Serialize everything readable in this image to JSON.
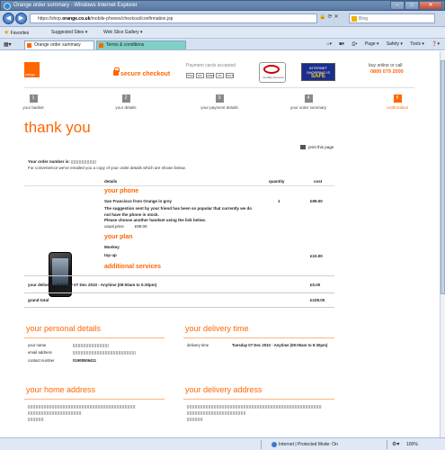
{
  "window": {
    "title": "Orange order summary - Windows Internet Explorer",
    "min": "–",
    "max": "□",
    "close": "✕"
  },
  "address": {
    "url_prefix": "https://shop.",
    "url_domain": "orange.co.uk",
    "url_suffix": "/mobile-phones/checkout/confirmation.jsp",
    "search_placeholder": "Bing"
  },
  "favorites": {
    "label": "Favorites",
    "items": [
      "Suggested Sites ▾",
      "Web Slice Gallery ▾"
    ]
  },
  "tabs": [
    {
      "label": "Orange order summary"
    },
    {
      "label": "Terms & conditions"
    }
  ],
  "commands": [
    "Page ▾",
    "Safety ▾",
    "Tools ▾",
    "❓▾"
  ],
  "header": {
    "logo_text": "orange",
    "secure": "secure checkout",
    "payment_label": "Payment cards accepted",
    "cards": [
      "VISA",
      "MC",
      "AMEX",
      "DC",
      "SOLO"
    ],
    "verisign": "VeriSign Secured",
    "safe_top": "INTERNET SHOPPING IS",
    "safe_word": "SAFE",
    "buy_online": "buy online or call",
    "phone": "0800 079 2000"
  },
  "steps": [
    {
      "num": "1",
      "label": "your basket"
    },
    {
      "num": "2",
      "label": "your details"
    },
    {
      "num": "3",
      "label": "your payment details"
    },
    {
      "num": "4",
      "label": "your order summary"
    },
    {
      "num": "5",
      "label": "confirmation"
    }
  ],
  "page": {
    "thank_you": "thank you",
    "print": "print this page",
    "order_number_label": "Your order number is:",
    "emailed": "For convenience we've emailed you a copy of your order details which are shown below."
  },
  "table": {
    "col_details": "details",
    "col_quantity": "quantity",
    "col_cost": "cost",
    "your_phone": "your phone",
    "phone_name": "San Francisco from Orange in grey",
    "phone_note": "The suggestion sent by your friend has been so popular that currently we do not have the phone in stock.",
    "phone_note2": "Please choose another handset using the link below.",
    "usual_price_label": "usual price",
    "usual_price": "£99.00",
    "phone_qty": "1",
    "phone_cost": "£99.00",
    "your_plan": "your plan",
    "plan_name": "Monkey",
    "top_up": "top up",
    "top_up_cost": "£10.00",
    "additional": "additional services",
    "delivery_row": "your delivery - Tuesday 07 Dec 2010 - Anytime (09:00am to 5:30pm)",
    "delivery_cost": "£0.00",
    "grand_total_label": "grand total",
    "grand_total": "£109.00"
  },
  "personal": {
    "title": "your personal details",
    "name_label": "your name",
    "email_label": "email address",
    "contact_label": "contact number",
    "contact_value": "01908506411"
  },
  "delivery_time": {
    "title": "your delivery time",
    "label": "delivery time",
    "value": "Tuesday 07 Dec 2010 - Anytime (09:00am to 5:30pm)"
  },
  "home_address": {
    "title": "your home address"
  },
  "delivery_address": {
    "title": "your delivery address"
  },
  "status": {
    "zone": "Internet | Protected Mode: On",
    "zoom": "100%"
  }
}
